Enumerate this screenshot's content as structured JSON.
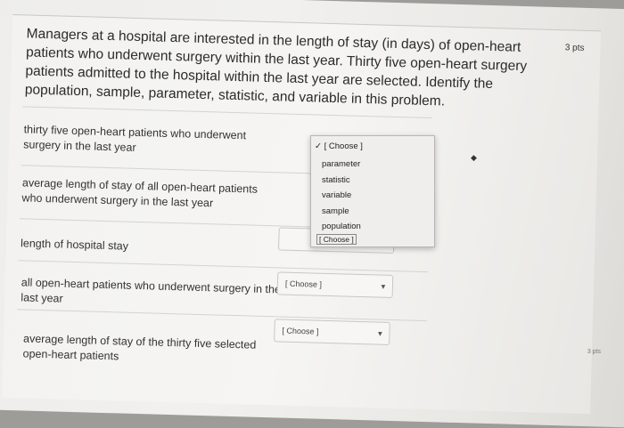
{
  "points": "3 pts",
  "question": {
    "main": "Managers at a hospital are interested in the length of stay (in days) of open-heart patients who underwent surgery within the last year. Thirty five open-heart surgery patients admitted to the hospital within the last year are selected. Identify the population, sample, parameter, statistic, and variable in this problem."
  },
  "rows": [
    {
      "label": "thirty five open-heart patients who underwent surgery in the last year",
      "selected": "[ Choose ]"
    },
    {
      "label": "average length of stay of all open-heart patients who underwent surgery in the last year",
      "selected": "[ Choose ]"
    },
    {
      "label": "length of hospital stay",
      "selected": "[ Choose ]"
    },
    {
      "label": "all open-heart patients who underwent surgery in the last year",
      "selected": "[ Choose ]"
    },
    {
      "label": "average length of stay of the thirty five selected open-heart patients",
      "selected": "[ Choose ]"
    }
  ],
  "dropdown": {
    "options": [
      "[ Choose ]",
      "parameter",
      "statistic",
      "variable",
      "sample",
      "population",
      "[ Choose ]"
    ],
    "check": "✓"
  },
  "mini_points": "3 pts"
}
